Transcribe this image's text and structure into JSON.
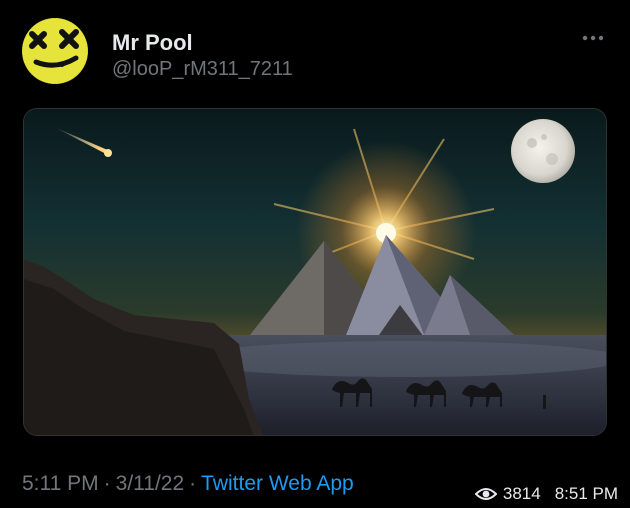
{
  "tweet": {
    "display_name": "Mr Pool",
    "handle": "@looP_rM311_7211",
    "more_icon": "more-dots-icon",
    "media_description_icon": "pyramids-photo",
    "meta": {
      "time": "5:11 PM",
      "date": "3/11/22",
      "separator": "·",
      "source": "Twitter Web App"
    }
  },
  "status_bar": {
    "views_icon": "eye-icon",
    "views": "3814",
    "clock": "8:51 PM"
  },
  "colors": {
    "background": "#000000",
    "text": "#e7e9ea",
    "muted": "#71767b",
    "link": "#1d9bf0",
    "avatar_yellow": "#e8e82c"
  }
}
